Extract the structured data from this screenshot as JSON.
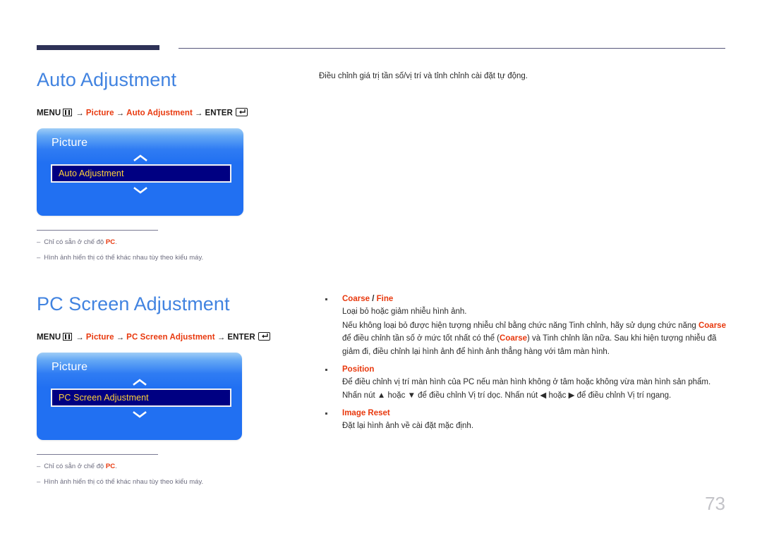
{
  "page": {
    "number": "73"
  },
  "sections": [
    {
      "id": "auto-adjustment",
      "heading": "Auto Adjustment",
      "menu_path": {
        "menu_label": "MENU",
        "menu_icon": "menu-grid-icon",
        "arrow": "→",
        "steps": [
          "Picture",
          "Auto Adjustment"
        ],
        "enter_label": "ENTER",
        "enter_icon": "enter-return-icon"
      },
      "osd": {
        "title": "Picture",
        "up_icon": "chevron-up-icon",
        "down_icon": "chevron-down-icon",
        "selected_item": "Auto Adjustment"
      },
      "notes": [
        {
          "dash": "–",
          "text_before": "Chỉ có sẵn ở chế độ ",
          "highlight": "PC",
          "text_after": "."
        },
        {
          "dash": "–",
          "text_before": "Hình ảnh hiển thị có thể khác nhau tùy theo kiểu máy.",
          "highlight": "",
          "text_after": ""
        }
      ]
    },
    {
      "id": "pc-screen-adjustment",
      "heading": "PC Screen Adjustment",
      "menu_path": {
        "menu_label": "MENU",
        "menu_icon": "menu-grid-icon",
        "arrow": "→",
        "steps": [
          "Picture",
          "PC Screen Adjustment"
        ],
        "enter_label": "ENTER",
        "enter_icon": "enter-return-icon"
      },
      "osd": {
        "title": "Picture",
        "up_icon": "chevron-up-icon",
        "down_icon": "chevron-down-icon",
        "selected_item": "PC Screen Adjustment"
      },
      "notes": [
        {
          "dash": "–",
          "text_before": "Chỉ có sẵn ở chế độ ",
          "highlight": "PC",
          "text_after": "."
        },
        {
          "dash": "–",
          "text_before": "Hình ảnh hiển thị có thể khác nhau tùy theo kiểu máy.",
          "highlight": "",
          "text_after": ""
        }
      ]
    }
  ],
  "right_column": {
    "lead_text": "Điều chỉnh giá trị tần số/vị trí và tỉnh chỉnh cài đặt tự động."
  },
  "bullets": [
    {
      "id": "coarse-fine",
      "title_part1": "Coarse",
      "title_sep": " / ",
      "title_part2": "Fine",
      "lines": [
        "Loại bỏ hoặc giảm nhiễu hình ảnh."
      ],
      "paragraph": {
        "seg1": "Nếu không loại bỏ được hiện tượng nhiễu chỉ bằng chức năng Tinh chỉnh, hãy sử dụng chức năng ",
        "hl1": "Coarse",
        "seg2": " để điều chỉnh tần số ở mức tốt nhất có thể (",
        "hl2": "Coarse",
        "seg3": ") và Tinh chỉnh lần nữa. Sau khi hiện tượng nhiễu đã giảm đi, điều chỉnh lại hình ảnh để hình ảnh thẳng hàng với tâm màn hình."
      }
    },
    {
      "id": "position",
      "title_part1": "Position",
      "title_sep": "",
      "title_part2": "",
      "lines": [
        "Để điều chỉnh vị trí màn hình của PC nếu màn hình không ở tâm hoặc không vừa màn hình sản phẩm.",
        "Nhấn nút ▲ hoặc ▼ để điều chỉnh Vị trí dọc. Nhấn nút ◀ hoặc ▶ để điều chỉnh Vị trí ngang."
      ],
      "paragraph": null
    },
    {
      "id": "image-reset",
      "title_part1": "Image Reset",
      "title_sep": "",
      "title_part2": "",
      "lines": [
        "Đặt lại hình ảnh về cài đặt mặc định."
      ],
      "paragraph": null
    }
  ],
  "colors": {
    "heading_blue": "#4183e0",
    "accent_red": "#e8380d",
    "rule_navy": "#2e3257",
    "osd_blue": "#2170f2",
    "osd_selected_navy": "#000082",
    "osd_selected_text": "#ffd23a",
    "note_gray": "#6e6e80",
    "page_number_gray": "#c3c3c8"
  }
}
